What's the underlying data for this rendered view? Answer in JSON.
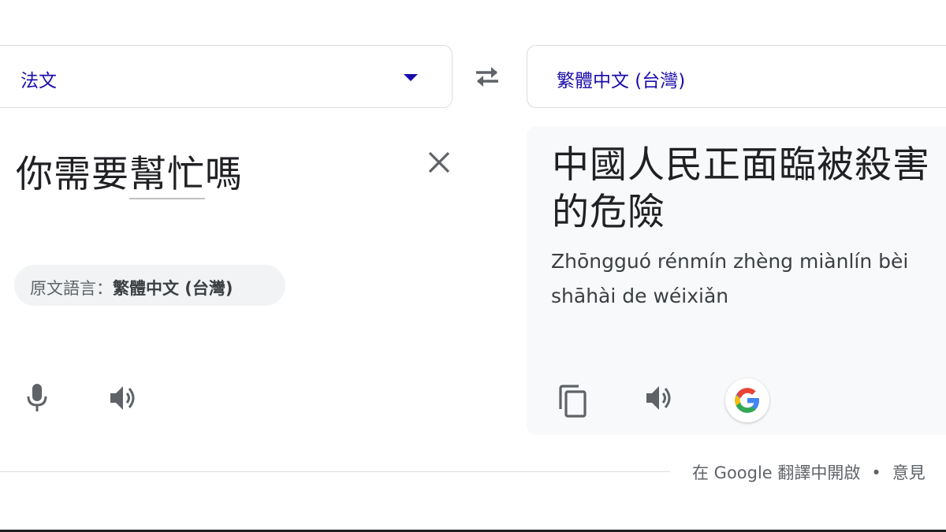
{
  "source_language": {
    "label": "法文"
  },
  "target_language": {
    "label": "繁體中文 (台灣)"
  },
  "source": {
    "text_plain": "你需要",
    "text_underlined": [
      "幫",
      "忙"
    ],
    "text_tail": "嗎"
  },
  "detected": {
    "prefix": "原文語言：",
    "language": "繁體中文 (台灣)"
  },
  "result": {
    "text": "中國人民正面臨被殺害的危險",
    "pinyin_line1": "Zhōngguó rénmín zhèng miànlín bèi",
    "pinyin_line2": "shāhài de wéixiǎn"
  },
  "footer": {
    "open_link": "在 Google 翻譯中開啟",
    "bullet": "•",
    "feedback_link": "意見"
  },
  "icons": [
    "dropdown-arrow-icon",
    "swap-icon",
    "close-icon",
    "microphone-icon",
    "speaker-icon",
    "copy-icon",
    "google-icon"
  ],
  "colors": {
    "accent": "#1a0dab",
    "panel_bg": "#f8f9fa",
    "chip_bg": "#f1f3f4",
    "text": "#202124"
  }
}
